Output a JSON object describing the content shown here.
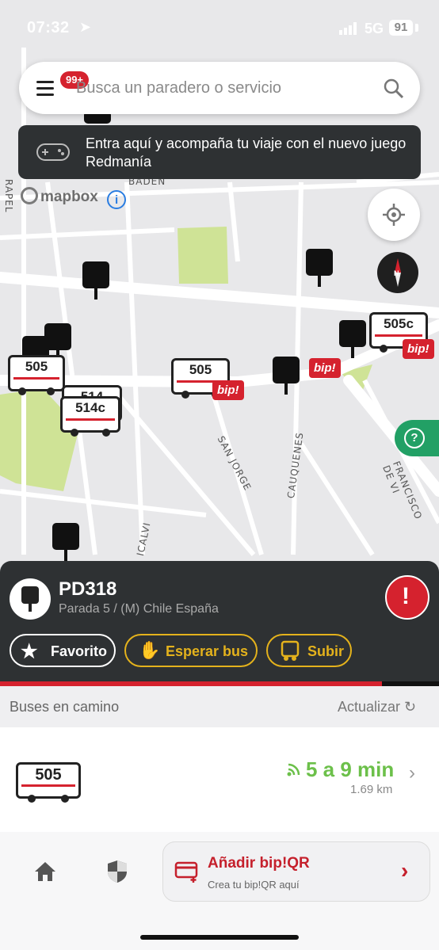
{
  "status_bar": {
    "time": "07:32",
    "network": "5G",
    "battery": "91"
  },
  "search": {
    "placeholder": "Busca un paradero o servicio",
    "badge": "99+"
  },
  "banner": {
    "text": "Entra aquí y acompaña tu viaje con el nuevo juego Redmanía"
  },
  "map": {
    "attribution": "mapbox",
    "streets": [
      "RAPEL",
      "BADEN",
      "SAN JORGE",
      "CAUQUENES",
      "FRANCISCO DE VI",
      "ICALVI"
    ],
    "buses": [
      "505",
      "514",
      "514c",
      "505",
      "505c"
    ],
    "bip_label": "bip!",
    "compass_label": "N"
  },
  "stop": {
    "code": "PD318",
    "name": "Parada 5 / (M) Chile España",
    "actions": {
      "favorite": "Favorito",
      "wait": "Esperar bus",
      "board": "Subir"
    },
    "progress": 0.87
  },
  "buses_section": {
    "title": "Buses en camino",
    "refresh": "Actualizar",
    "items": [
      {
        "route": "505",
        "eta": "5 a 9 min",
        "distance": "1.69 km"
      }
    ]
  },
  "bottom": {
    "bipqr_title": "Añadir bip!QR",
    "bipqr_subtitle": "Crea tu bip!QR aquí"
  },
  "colors": {
    "accent_red": "#d5222e",
    "dark_panel": "#2e3133",
    "eta_green": "#6cc04a",
    "gold": "#e4b21c"
  }
}
